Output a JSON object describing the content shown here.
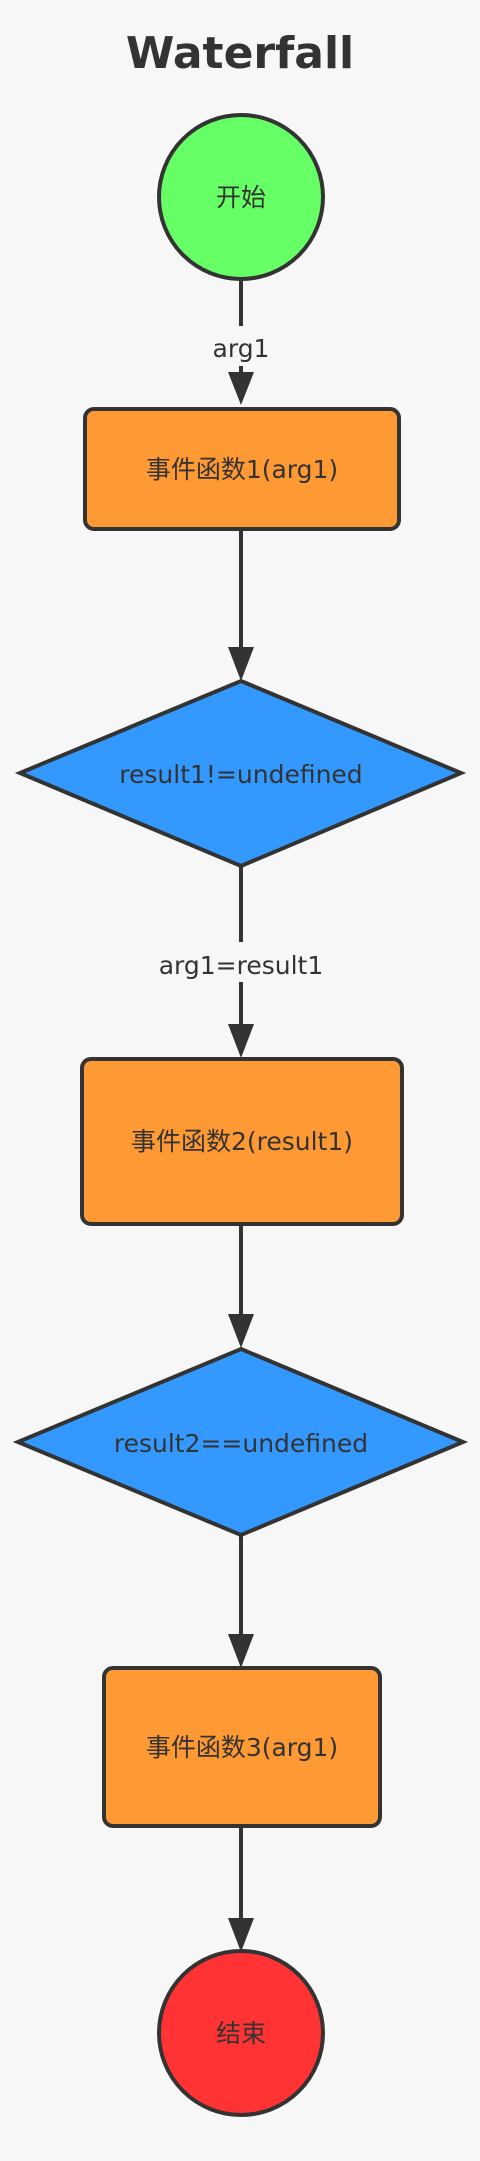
{
  "title": "Waterfall",
  "nodes": {
    "start": {
      "label": "开始",
      "color": "#66ff66"
    },
    "event1": {
      "label": "事件函数1(arg1)",
      "color": "#ff9933"
    },
    "decision1": {
      "label": "result1!=undefined",
      "color": "#3399ff"
    },
    "event2": {
      "label": "事件函数2(result1)",
      "color": "#ff9933"
    },
    "decision2": {
      "label": "result2==undefined",
      "color": "#3399ff"
    },
    "event3": {
      "label": "事件函数3(arg1)",
      "color": "#ff9933"
    },
    "end": {
      "label": "结束",
      "color": "#ff3333"
    }
  },
  "edges": {
    "start_to_event1": {
      "label": "arg1"
    },
    "decision1_to_event2": {
      "label": "arg1=result1"
    }
  },
  "colors": {
    "stroke": "#333333",
    "background": "#f7f7f7"
  }
}
